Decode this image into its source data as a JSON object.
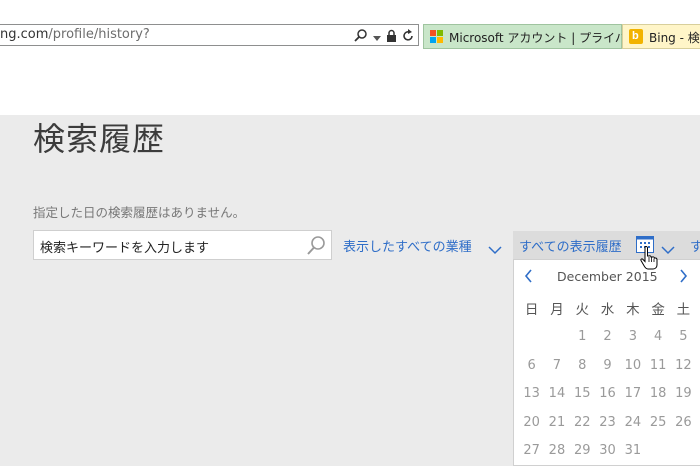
{
  "browser": {
    "address_prefix": "ng.com",
    "address_path": "/profile/history?",
    "tabs": [
      {
        "label": "Microsoft アカウント | プライバシー"
      },
      {
        "label": "Bing - 検"
      }
    ]
  },
  "page": {
    "title": "検索履歴",
    "notice": "指定した日の検索履歴はありません。",
    "search": {
      "value": "検索キーワードを入力します"
    },
    "filters": {
      "industry": "表示したすべての業種",
      "history": "すべての表示履歴",
      "cut": "す"
    },
    "calendar": {
      "month_label": "December 2015",
      "weekdays": [
        "日",
        "月",
        "火",
        "水",
        "木",
        "金",
        "土"
      ],
      "weeks": [
        [
          "",
          "",
          "1",
          "2",
          "3",
          "4",
          "5"
        ],
        [
          "6",
          "7",
          "8",
          "9",
          "10",
          "11",
          "12"
        ],
        [
          "13",
          "14",
          "15",
          "16",
          "17",
          "18",
          "19"
        ],
        [
          "20",
          "21",
          "22",
          "23",
          "24",
          "25",
          "26"
        ],
        [
          "27",
          "28",
          "29",
          "30",
          "31",
          "",
          ""
        ]
      ]
    }
  },
  "colors": {
    "link": "#2f6ec8",
    "background": "#ebebeb",
    "tab_active": "#c9e6c9",
    "tab_bing": "#fff5c8"
  },
  "icons": [
    "search-icon",
    "dropdown-icon",
    "lock-icon",
    "refresh-icon",
    "microsoft-logo-icon",
    "bing-logo-icon",
    "calendar-icon",
    "chevron-down-icon",
    "chevron-left-icon",
    "chevron-right-icon",
    "hand-cursor-icon"
  ]
}
